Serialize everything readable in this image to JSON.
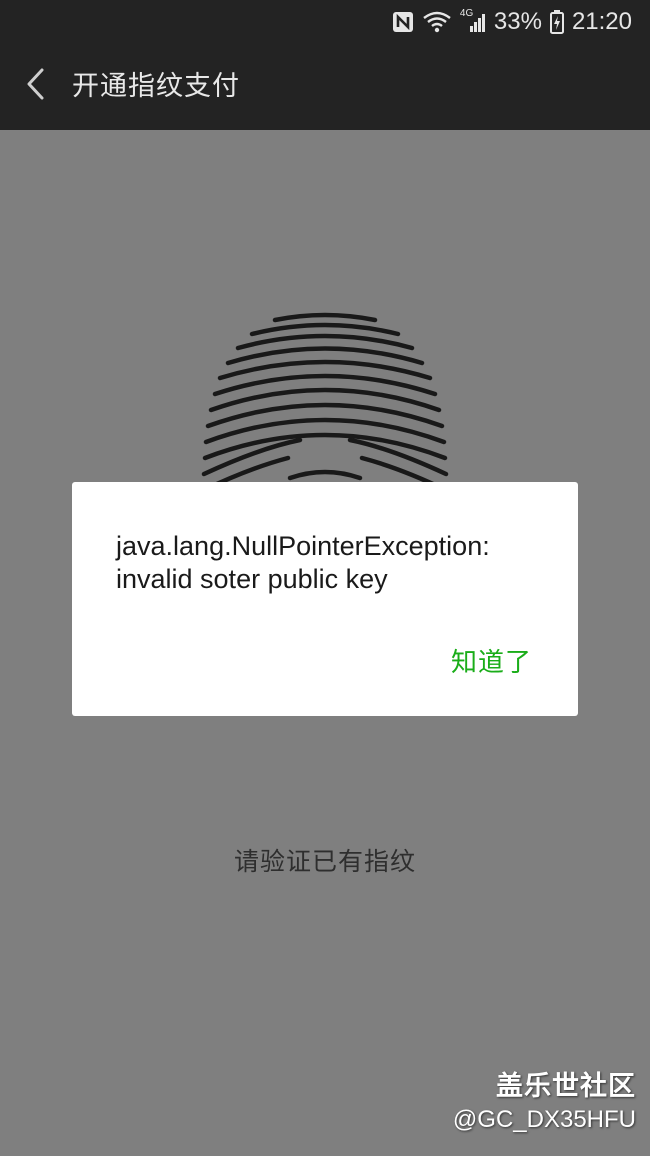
{
  "status_bar": {
    "battery_percent": "33%",
    "time": "21:20",
    "network_label": "4G",
    "icons": [
      "nfc-icon",
      "wifi-icon",
      "signal-icon",
      "battery-charging-icon"
    ]
  },
  "action_bar": {
    "back_icon": "chevron-left-icon",
    "title": "开通指纹支付"
  },
  "content": {
    "fingerprint_icon": "fingerprint-icon",
    "prompt": "请验证已有指纹"
  },
  "dialog": {
    "message": "java.lang.NullPointerException: invalid soter public key",
    "button_label": "知道了"
  },
  "watermark": {
    "title": "盖乐世社区",
    "handle": "@GC_DX35HFU"
  },
  "colors": {
    "accent": "#1aad19",
    "bar_background": "#232323",
    "overlay": "rgba(0,0,0,0.5)"
  }
}
